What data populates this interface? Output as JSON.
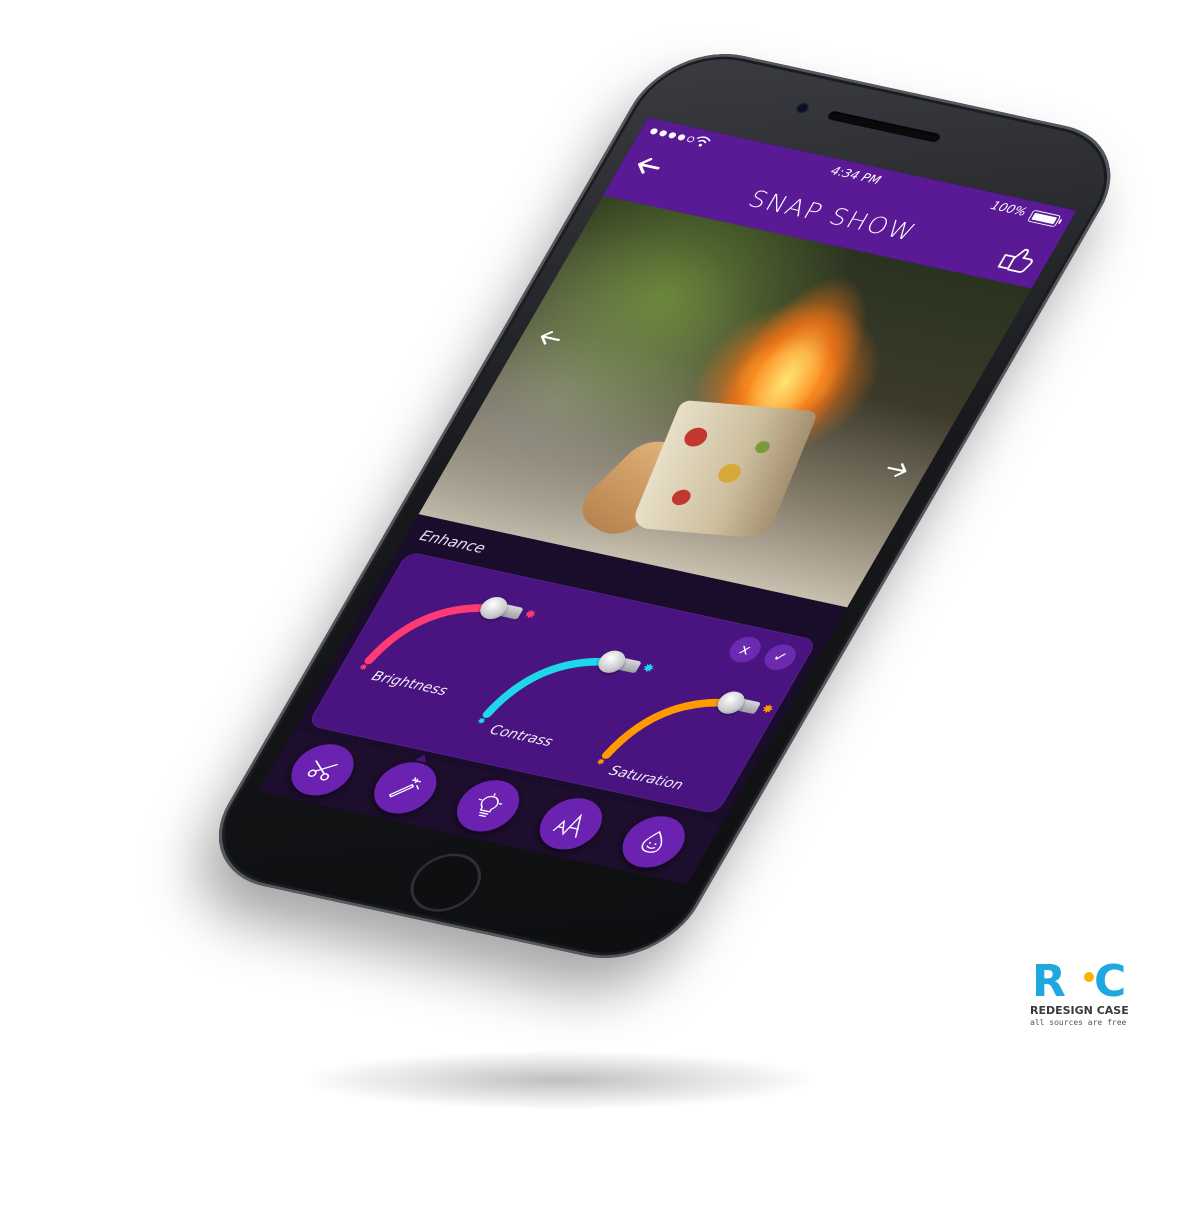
{
  "statusbar": {
    "time": "4:34 PM",
    "battery": "100%"
  },
  "header": {
    "title": "SNAP SHOW"
  },
  "enhance": {
    "label": "Enhance",
    "close_label": "x",
    "confirm_label": "✓",
    "sliders": [
      {
        "label": "Brightness",
        "color": "#ff3b74",
        "level": 0.8
      },
      {
        "label": "Contrass",
        "color": "#1ed7ea",
        "level": 0.8
      },
      {
        "label": "Saturation",
        "color": "#ff9a00",
        "level": 0.8
      }
    ]
  },
  "toolbar": {
    "tools": [
      {
        "name": "scissors-icon"
      },
      {
        "name": "magic-wand-icon"
      },
      {
        "name": "lightbulb-icon"
      },
      {
        "name": "text-icon"
      },
      {
        "name": "sticker-icon"
      }
    ]
  },
  "watermark": {
    "logo_r": "R",
    "logo_c": "C",
    "title": "REDESIGN CASE",
    "subtitle": "all sources are free"
  }
}
